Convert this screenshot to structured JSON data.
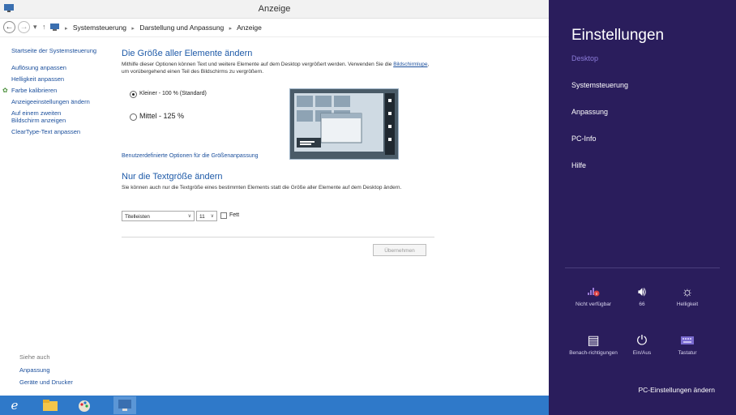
{
  "window": {
    "title": "Anzeige"
  },
  "address": {
    "back_icon": "back-arrow-icon",
    "forward_icon": "forward-arrow-icon",
    "breadcrumb": [
      "Systemsteuerung",
      "Darstellung und Anpassung",
      "Anzeige"
    ]
  },
  "sidebar": {
    "home": "Startseite der Systemsteuerung",
    "items": [
      {
        "label": "Auflösung anpassen"
      },
      {
        "label": "Helligkeit anpassen"
      },
      {
        "label": "Farbe kalibrieren"
      },
      {
        "label": "Anzeigeeinstellungen ändern"
      },
      {
        "label": "Auf einem zweiten Bildschirm anzeigen"
      },
      {
        "label": "ClearType-Text anpassen"
      }
    ],
    "see_also": "Siehe auch",
    "see_also_links": [
      "Anpassung",
      "Geräte und Drucker"
    ]
  },
  "main": {
    "heading": "Die Größe aller Elemente ändern",
    "desc_part1": "Mithilfe dieser Optionen können Text und weitere Elemente auf dem Desktop vergrößert werden. Verwenden Sie die ",
    "desc_link": "Bildschirmlupe",
    "desc_part2": ", um vorübergehend einen Teil des Bildschirms zu vergrößern.",
    "options": [
      {
        "label": "Kleiner - 100 % (Standard)",
        "selected": true
      },
      {
        "label": "Mittel - 125 %",
        "selected": false
      }
    ],
    "custom_link": "Benutzerdefinierte Optionen für die Größenanpassung",
    "heading2": "Nur die Textgröße ändern",
    "desc2": "Sie können auch nur die Textgröße eines bestimmten Elements statt die Größe aller Elemente auf dem Desktop ändern.",
    "element_select": "Titelleisten",
    "size_select": "11",
    "bold_label": "Fett",
    "bold_checked": false,
    "apply_label": "Übernehmen"
  },
  "charm": {
    "title": "Einstellungen",
    "items": [
      {
        "label": "Desktop",
        "active": true
      },
      {
        "label": "Systemsteuerung",
        "active": false
      },
      {
        "label": "Anpassung",
        "active": false
      },
      {
        "label": "PC-Info",
        "active": false
      },
      {
        "label": "Hilfe",
        "active": false
      }
    ],
    "quick": [
      {
        "label": "Nicht verfügbar",
        "icon": "network-unavailable-icon"
      },
      {
        "label": "66",
        "icon": "volume-icon"
      },
      {
        "label": "Helligkeit",
        "icon": "brightness-icon"
      },
      {
        "label": "Benach-richtigungen",
        "icon": "notifications-icon"
      },
      {
        "label": "Ein/Aus",
        "icon": "power-icon"
      },
      {
        "label": "Tastatur",
        "icon": "keyboard-icon"
      }
    ],
    "pc_settings": "PC-Einstellungen ändern"
  },
  "colors": {
    "charm_bg": "#2a1d5c",
    "taskbar": "#2f79c9",
    "heading_blue": "#1e5aa8",
    "link_blue": "#1b4f9c"
  }
}
